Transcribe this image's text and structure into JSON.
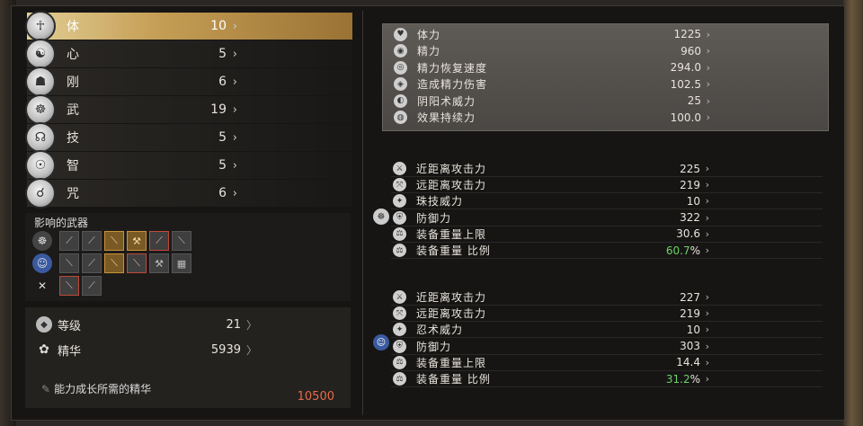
{
  "attributes": [
    {
      "name": "体",
      "value": "10",
      "icon": "body-icon",
      "selected": true
    },
    {
      "name": "心",
      "value": "5",
      "icon": "heart-icon"
    },
    {
      "name": "刚",
      "value": "6",
      "icon": "strength-icon"
    },
    {
      "name": "武",
      "value": "19",
      "icon": "martial-icon"
    },
    {
      "name": "技",
      "value": "5",
      "icon": "skill-icon"
    },
    {
      "name": "智",
      "value": "5",
      "icon": "wisdom-icon"
    },
    {
      "name": "咒",
      "value": "6",
      "icon": "spell-icon"
    }
  ],
  "arrow": "›",
  "weapons": {
    "title": "影响的武器"
  },
  "level": {
    "label": "等级",
    "value": "21",
    "arrow": "〉"
  },
  "amrita": {
    "label": "精华",
    "value": "5939",
    "arrow": "〉"
  },
  "cost": {
    "label": "能力成长所需的精华",
    "value": "10500"
  },
  "top_stats": [
    {
      "label": "体力",
      "value": "1225"
    },
    {
      "label": "精力",
      "value": "960"
    },
    {
      "label": "精力恢复速度",
      "value": "294.0"
    },
    {
      "label": "造成精力伤害",
      "value": "102.5"
    },
    {
      "label": "阴阳术威力",
      "value": "25"
    },
    {
      "label": "效果持续力",
      "value": "100.0"
    }
  ],
  "weapon1_stats": [
    {
      "label": "近距离攻击力",
      "value": "225"
    },
    {
      "label": "远距离攻击力",
      "value": "219"
    },
    {
      "label": "珠技威力",
      "value": "10"
    },
    {
      "label": "防御力",
      "value": "322"
    },
    {
      "label": "装备重量上限",
      "value": "30.6"
    },
    {
      "label": "装备重量 比例",
      "value": "60.7",
      "unit": "%",
      "highlight": true
    }
  ],
  "weapon2_stats": [
    {
      "label": "近距离攻击力",
      "value": "227"
    },
    {
      "label": "远距离攻击力",
      "value": "219"
    },
    {
      "label": "忍术威力",
      "value": "10"
    },
    {
      "label": "防御力",
      "value": "303"
    },
    {
      "label": "装备重量上限",
      "value": "14.4"
    },
    {
      "label": "装备重量 比例",
      "value": "31.2",
      "unit": "%",
      "highlight": true
    }
  ],
  "colors": {
    "selected": "#c59e55",
    "highlight": "#6fd06a",
    "cost": "#e86a4a"
  }
}
